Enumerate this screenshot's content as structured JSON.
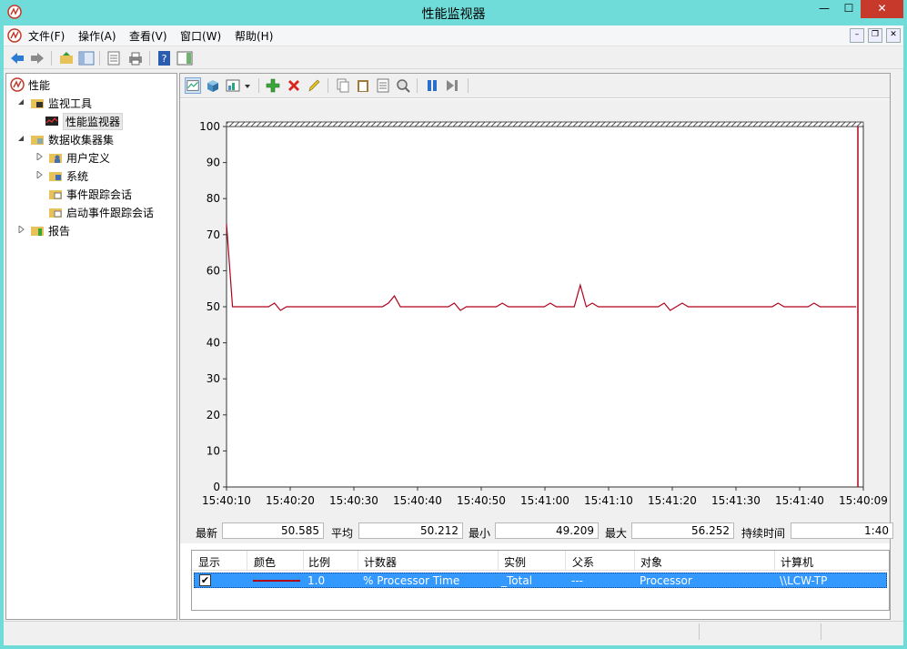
{
  "window": {
    "title": "性能监视器"
  },
  "menu": {
    "items": [
      "文件(F)",
      "操作(A)",
      "查看(V)",
      "窗口(W)",
      "帮助(H)"
    ]
  },
  "tree": {
    "items": [
      {
        "label": "性能",
        "level": 0
      },
      {
        "label": "监视工具",
        "level": 1
      },
      {
        "label": "性能监视器",
        "level": 2
      },
      {
        "label": "数据收集器集",
        "level": 1
      },
      {
        "label": "用户定义",
        "level": 2
      },
      {
        "label": "系统",
        "level": 2
      },
      {
        "label": "事件跟踪会话",
        "level": 2
      },
      {
        "label": "启动事件跟踪会话",
        "level": 2
      },
      {
        "label": "报告",
        "level": 1
      }
    ]
  },
  "stats": {
    "last_label": "最新",
    "last_value": "50.585",
    "avg_label": "平均",
    "avg_value": "50.212",
    "min_label": "最小",
    "min_value": "49.209",
    "max_label": "最大",
    "max_value": "56.252",
    "dur_label": "持续时间",
    "dur_value": "1:40"
  },
  "legend": {
    "headers": [
      "显示",
      "颜色",
      "比例",
      "计数器",
      "实例",
      "父系",
      "对象",
      "计算机"
    ],
    "row": {
      "checked": "✔",
      "scale": "1.0",
      "counter": "% Processor Time",
      "instance": "_Total",
      "parent": "---",
      "object": "Processor",
      "computer": "\\\\LCW-TP"
    }
  },
  "colors": {
    "series": "#b0001a",
    "selection": "#3399ff",
    "titlebar": "#6fdcd9"
  },
  "chart_data": {
    "type": "line",
    "title": "",
    "xlabel": "",
    "ylabel": "",
    "ylim": [
      0,
      100
    ],
    "yticks": [
      0,
      10,
      20,
      30,
      40,
      50,
      60,
      70,
      80,
      90,
      100
    ],
    "xticks": [
      "15:40:10",
      "15:40:20",
      "15:40:30",
      "15:40:40",
      "15:40:50",
      "15:41:00",
      "15:41:10",
      "15:41:20",
      "15:41:30",
      "15:41:40",
      "15:40:09"
    ],
    "grid": false,
    "series": [
      {
        "values": [
          73,
          50,
          50,
          50,
          50,
          50,
          50,
          50,
          51,
          49,
          50,
          50,
          50,
          50,
          50,
          50,
          50,
          50,
          50,
          50,
          50,
          50,
          50,
          50,
          50,
          50,
          50,
          51,
          53,
          50,
          50,
          50,
          50,
          50,
          50,
          50,
          50,
          50,
          51,
          49,
          50,
          50,
          50,
          50,
          50,
          50,
          51,
          50,
          50,
          50,
          50,
          50,
          50,
          50,
          51,
          50,
          50,
          50,
          50,
          56,
          50,
          51,
          50,
          50,
          50,
          50,
          50,
          50,
          50,
          50,
          50,
          50,
          50,
          51,
          49,
          50,
          51,
          50,
          50,
          50,
          50,
          50,
          50,
          50,
          50,
          50,
          50,
          50,
          50,
          50,
          50,
          50,
          51,
          50,
          50,
          50,
          50,
          50,
          51,
          50,
          50,
          50,
          50,
          50,
          50,
          50
        ]
      }
    ]
  }
}
